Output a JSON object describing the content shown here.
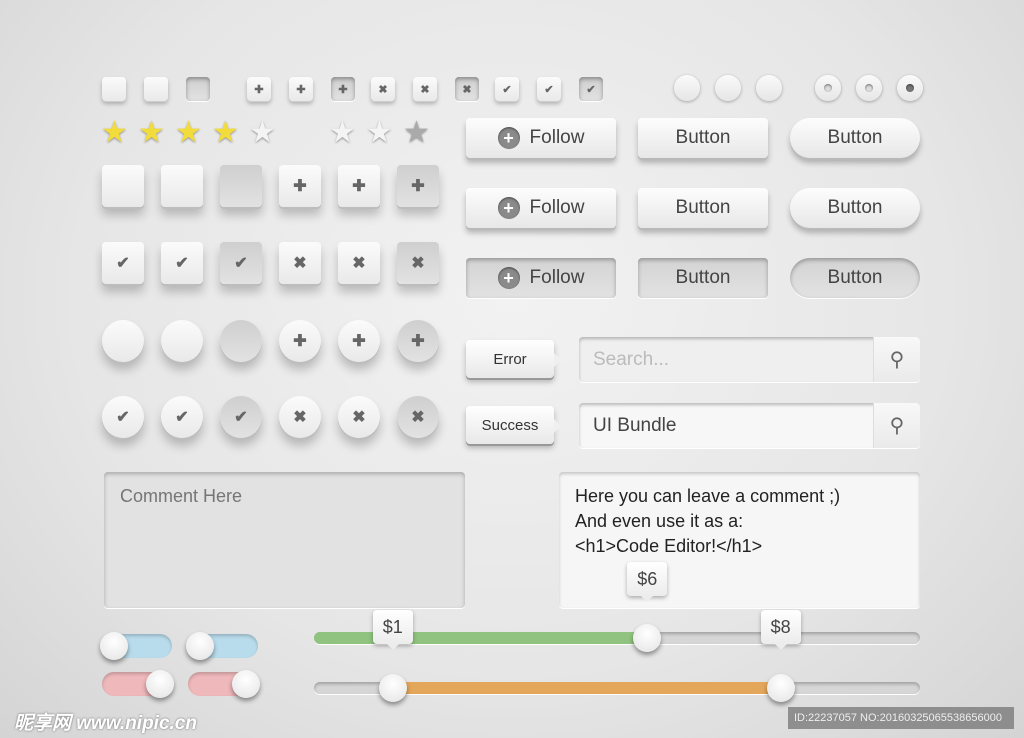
{
  "small_controls": {
    "checkboxes": [
      "empty",
      "empty",
      "pressed"
    ],
    "plus": [
      "plus",
      "plus",
      "pressed"
    ],
    "cross": [
      "cross",
      "cross",
      "pressed"
    ],
    "check": [
      "check",
      "check",
      "pressed"
    ],
    "radios": [
      "empty",
      "empty",
      "empty"
    ],
    "radio_dots": [
      "dot",
      "dot",
      "selected"
    ]
  },
  "rating_left": {
    "value": 4,
    "max": 5
  },
  "rating_right": {
    "value": 0,
    "max": 3
  },
  "buttons": {
    "follow_label": "Follow",
    "button_label": "Button",
    "rows": [
      "normal",
      "hover",
      "pressed"
    ]
  },
  "big_controls": {
    "rows": [
      {
        "shape": "square",
        "icons": [
          "",
          "",
          "",
          "plus",
          "plus",
          "plus"
        ]
      },
      {
        "shape": "square",
        "icons": [
          "check",
          "check",
          "check",
          "cross",
          "cross",
          "cross"
        ]
      },
      {
        "shape": "circle",
        "icons": [
          "",
          "",
          "",
          "plus",
          "plus",
          "plus"
        ]
      },
      {
        "shape": "circle",
        "icons": [
          "check",
          "check",
          "check",
          "cross",
          "cross",
          "cross"
        ]
      }
    ]
  },
  "tags": {
    "error": "Error",
    "success": "Success"
  },
  "search": {
    "placeholder": "Search...",
    "value": "UI Bundle"
  },
  "comment": {
    "placeholder": "Comment Here",
    "value": "Here you can leave a comment ;)\nAnd even use it as a:\n<h1>Code Editor!</h1>"
  },
  "toggles": [
    {
      "color": "#b9dcec",
      "on": false
    },
    {
      "color": "#b9dcec",
      "on": false
    },
    {
      "color": "#efb8bb",
      "on": true
    },
    {
      "color": "#efb8bb",
      "on": true
    }
  ],
  "slider1": {
    "label": "$6",
    "fraction": 0.55,
    "color": "#8fc37f"
  },
  "slider2": {
    "low_label": "$1",
    "high_label": "$8",
    "low": 0.13,
    "high": 0.77,
    "color": "#e3a65a"
  },
  "watermark": {
    "logo": "昵享网 www.nipic.cn",
    "id": "ID:22237057 NO:20160325065538656000"
  }
}
